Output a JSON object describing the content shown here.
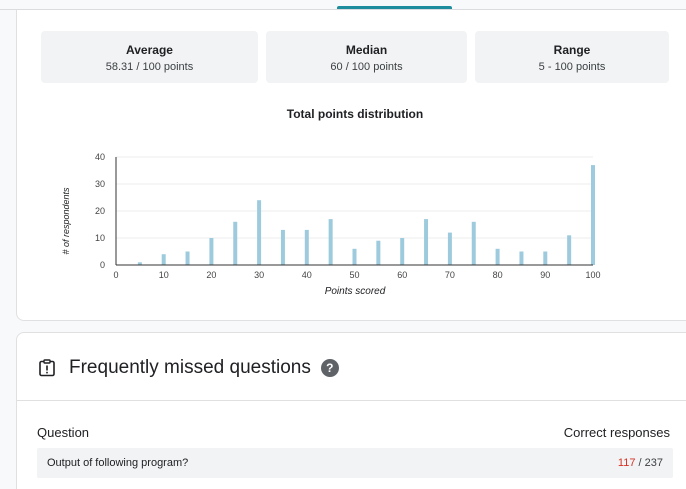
{
  "summary": {
    "average": {
      "label": "Average",
      "value": "58.31 / 100 points"
    },
    "median": {
      "label": "Median",
      "value": "60 / 100 points"
    },
    "range": {
      "label": "Range",
      "value": "5 - 100 points"
    }
  },
  "chart_data": {
    "type": "bar",
    "title": "Total points distribution",
    "xlabel": "Points scored",
    "ylabel": "# of respondents",
    "x": [
      5,
      10,
      15,
      20,
      25,
      30,
      35,
      40,
      45,
      50,
      55,
      60,
      65,
      70,
      75,
      80,
      85,
      90,
      95,
      100
    ],
    "values": [
      1,
      4,
      5,
      10,
      16,
      24,
      13,
      13,
      17,
      6,
      9,
      10,
      17,
      12,
      16,
      6,
      5,
      5,
      11,
      37
    ],
    "xlim": [
      0,
      100
    ],
    "ylim": [
      0,
      40
    ],
    "xticks": [
      0,
      10,
      20,
      30,
      40,
      50,
      60,
      70,
      80,
      90,
      100
    ],
    "yticks": [
      0,
      10,
      20,
      30,
      40
    ],
    "grid": true,
    "bar_color": "#9dcbdd"
  },
  "missed": {
    "title": "Frequently missed questions",
    "help_glyph": "?",
    "col_question": "Question",
    "col_correct": "Correct responses",
    "rows": [
      {
        "question": "Output of following program?",
        "correct": "117",
        "total": " / 237"
      }
    ]
  },
  "colors": {
    "accent": "#1e8e9e",
    "bar": "#9dcbdd",
    "incorrect": "#d93025"
  }
}
